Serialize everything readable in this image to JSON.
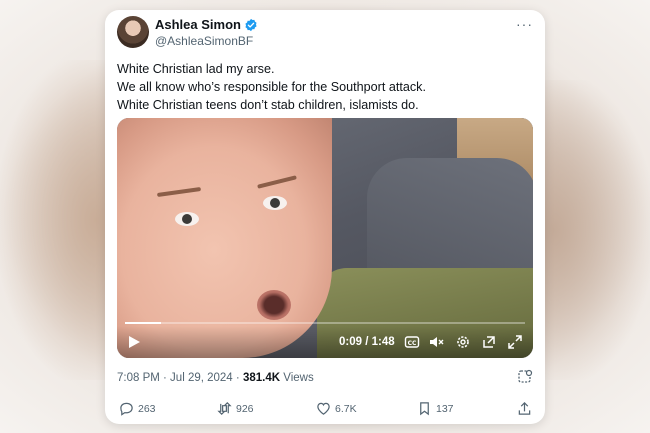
{
  "tweet": {
    "display_name": "Ashlea Simon",
    "handle": "@AshleaSimonBF",
    "more_label": "···",
    "lines": [
      "White Christian lad my arse.",
      "We all know who’s responsible for the Southport attack.",
      "White Christian teens don’t stab children, islamists do."
    ],
    "timestamp": "7:08 PM · Jul 29, 2024 · ",
    "views_count": "381.4K",
    "views_label": " Views"
  },
  "video": {
    "time": "0:09 / 1:48",
    "progress_fraction": 0.09,
    "icons": [
      "play-icon",
      "captions-icon",
      "mute-icon",
      "settings-icon",
      "popout-icon",
      "fullscreen-icon"
    ]
  },
  "actions": {
    "replies": "263",
    "reposts": "926",
    "likes": "6.7K",
    "bookmarks": "137"
  },
  "colors": {
    "verified": "#1d9bf0",
    "text": "#0f1419",
    "secondary": "#536471"
  }
}
